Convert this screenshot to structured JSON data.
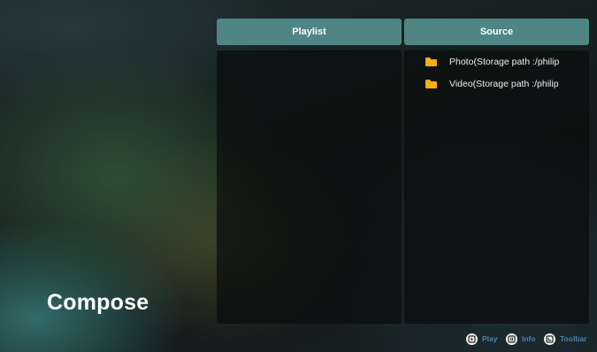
{
  "header": {
    "playlist_label": "Playlist",
    "source_label": "Source"
  },
  "source": {
    "items": [
      {
        "label": "Photo(Storage path :/philip",
        "icon": "folder-icon"
      },
      {
        "label": "Video(Storage path :/philip",
        "icon": "folder-icon"
      }
    ]
  },
  "page": {
    "title": "Compose"
  },
  "hints": [
    {
      "label": "Play",
      "icon": "play-button-icon"
    },
    {
      "label": "Info",
      "icon": "info-button-icon"
    },
    {
      "label": "Toolbar",
      "icon": "toolbar-button-icon"
    }
  ],
  "colors": {
    "header_background": "#4f8583",
    "folder": "#f7ae15",
    "hint_text": "#4a7fae"
  }
}
